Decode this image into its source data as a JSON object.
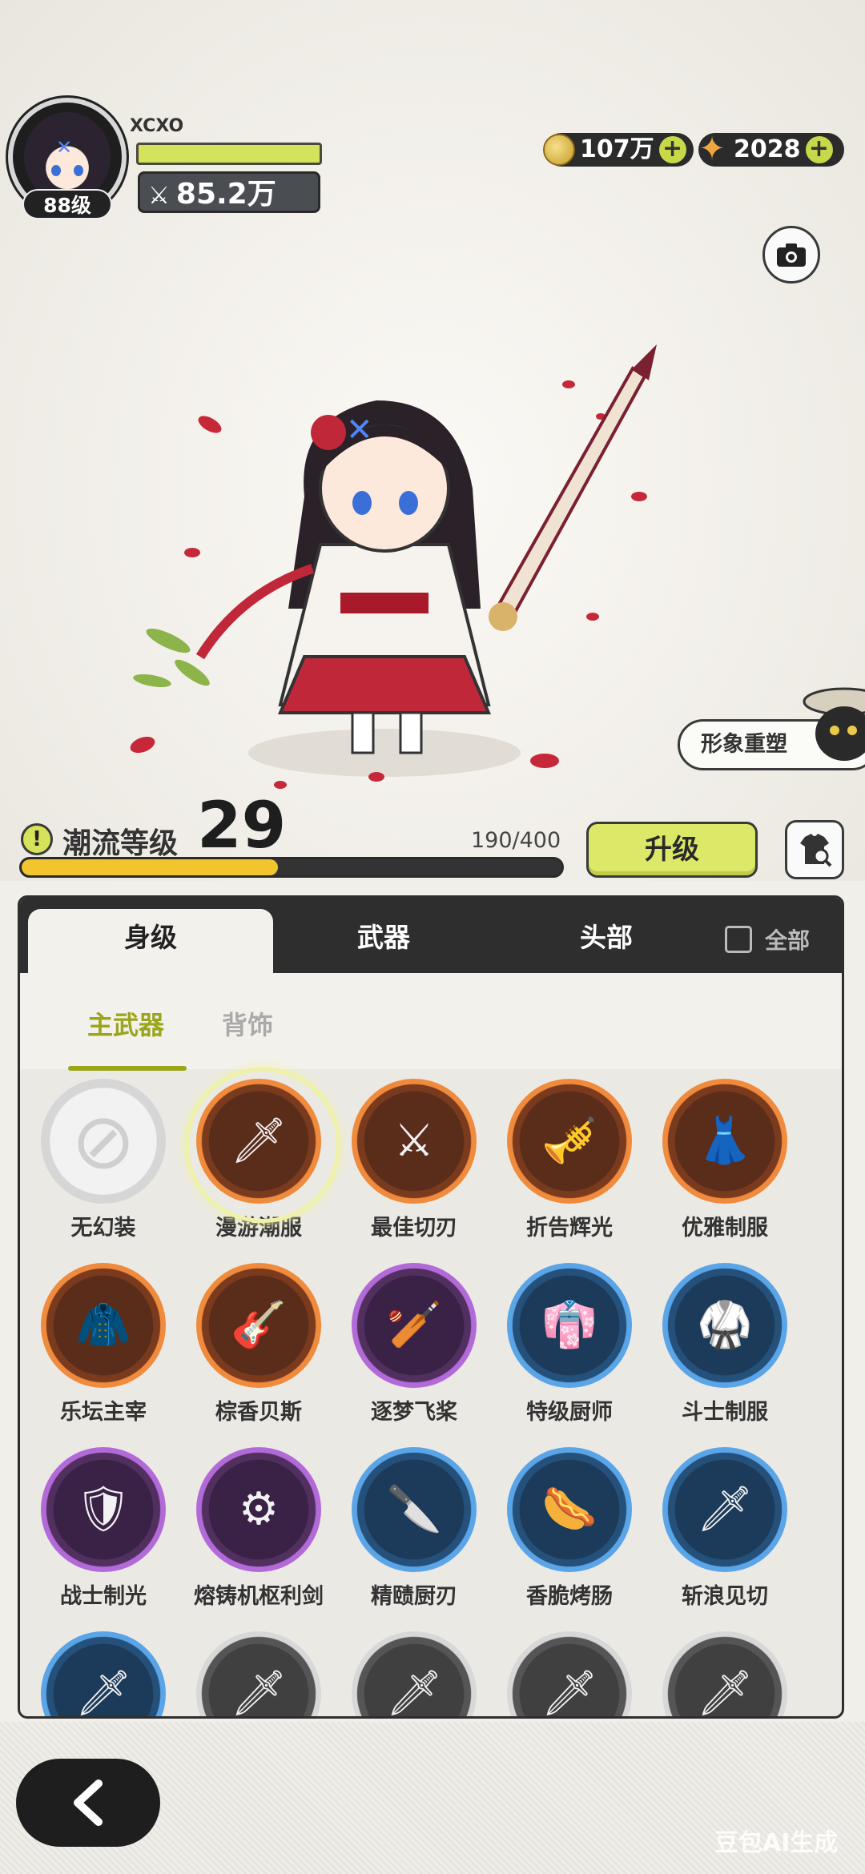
{
  "player": {
    "name": "XCXO",
    "level": "88级",
    "power": "85.2万"
  },
  "currencies": [
    {
      "name": "gold",
      "value": "107万"
    },
    {
      "name": "star",
      "value": "2028"
    }
  ],
  "reshape_button": "形象重塑",
  "trend": {
    "label": "潮流等级",
    "level": "29",
    "progress_text": "190/400",
    "progress_fraction": 0.475,
    "upgrade_label": "升级"
  },
  "tabs": [
    {
      "label": "身级",
      "active": true
    },
    {
      "label": "武器",
      "active": false
    },
    {
      "label": "头部",
      "active": false
    }
  ],
  "all_toggle_label": "全部",
  "subtabs": [
    {
      "label": "主武器",
      "active": true
    },
    {
      "label": "背饰",
      "active": false
    }
  ],
  "items": [
    {
      "label": "无幻装",
      "rarity": "empty",
      "icon": "none-icon",
      "selected": false
    },
    {
      "label": "漫游潮服",
      "rarity": "orange",
      "icon": "winged-sword-icon",
      "selected": true
    },
    {
      "label": "最佳切刃",
      "rarity": "orange",
      "icon": "blade-icon",
      "selected": false
    },
    {
      "label": "折告辉光",
      "rarity": "orange",
      "icon": "trumpet-icon",
      "selected": false
    },
    {
      "label": "优雅制服",
      "rarity": "orange",
      "icon": "maid-dress-icon",
      "selected": false
    },
    {
      "label": "乐坛主宰",
      "rarity": "orange",
      "icon": "red-outfit-icon",
      "selected": false
    },
    {
      "label": "棕香贝斯",
      "rarity": "orange",
      "icon": "bass-axe-icon",
      "selected": false
    },
    {
      "label": "逐梦飞桨",
      "rarity": "purple",
      "icon": "paddle-icon",
      "selected": false
    },
    {
      "label": "特级厨师",
      "rarity": "blue",
      "icon": "chef-outfit-icon",
      "selected": false
    },
    {
      "label": "斗士制服",
      "rarity": "blue",
      "icon": "fighter-outfit-icon",
      "selected": false
    },
    {
      "label": "战士制光",
      "rarity": "purple",
      "icon": "warrior-outfit-icon",
      "selected": false
    },
    {
      "label": "熔铸机枢利剑",
      "rarity": "purple",
      "icon": "forged-sword-icon",
      "selected": false
    },
    {
      "label": "精赜厨刃",
      "rarity": "blue",
      "icon": "cleaver-icon",
      "selected": false
    },
    {
      "label": "香脆烤肠",
      "rarity": "blue",
      "icon": "sausage-icon",
      "selected": false
    },
    {
      "label": "斩浪见切",
      "rarity": "blue",
      "icon": "wave-blade-icon",
      "selected": false
    },
    {
      "label": "",
      "rarity": "blue",
      "icon": "sword-icon",
      "selected": false
    },
    {
      "label": "",
      "rarity": "dark",
      "icon": "sword-icon",
      "selected": false
    },
    {
      "label": "",
      "rarity": "dark",
      "icon": "sword-icon",
      "selected": false
    },
    {
      "label": "",
      "rarity": "dark",
      "icon": "sword-icon",
      "selected": false
    },
    {
      "label": "",
      "rarity": "dark",
      "icon": "sword-icon",
      "selected": false
    }
  ],
  "watermark": "豆包AI生成"
}
